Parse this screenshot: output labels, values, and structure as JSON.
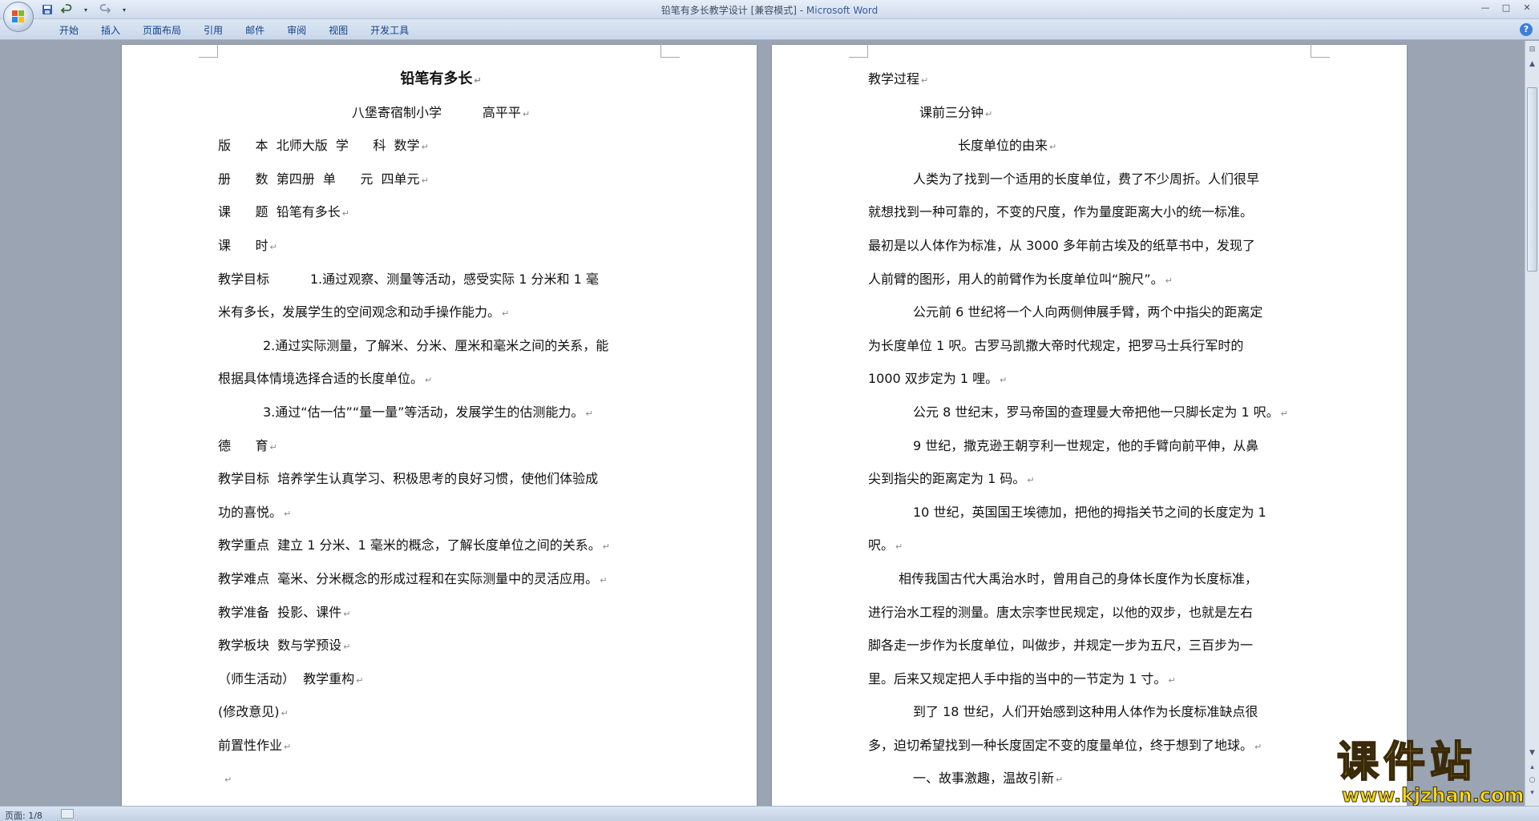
{
  "window": {
    "title": "铅笔有多长教学设计 [兼容模式] - ",
    "app_name": "Microsoft Word"
  },
  "qat": {
    "save_icon": "save-icon",
    "undo_icon": "undo-icon",
    "redo_icon": "redo-icon",
    "customize_icon": "dropdown-icon"
  },
  "ribbon": {
    "tabs": [
      "开始",
      "插入",
      "页面布局",
      "引用",
      "邮件",
      "审阅",
      "视图",
      "开发工具"
    ],
    "help": "?"
  },
  "page1": {
    "title": "铅笔有多长",
    "author_line": "八堡寄宿制小学          高平平",
    "lines": [
      "版      本  北师大版  学      科  数学",
      "册      数  第四册  单      元  四单元",
      "课      题  铅笔有多长",
      "课      时",
      "教学目标          1.通过观察、测量等活动，感受实际 1 分米和 1 毫",
      "米有多长，发展学生的空间观念和动手操作能力。",
      "2.通过实际测量，了解米、分米、厘米和毫米之间的关系，能",
      "根据具体情境选择合适的长度单位。",
      "3.通过“估一估”“量一量”等活动，发展学生的估测能力。",
      "德      育",
      "教学目标  培养学生认真学习、积极思考的良好习惯，使他们体验成",
      "功的喜悦。",
      "教学重点  建立 1 分米、1 毫米的概念，了解长度单位之间的关系。",
      "教学难点  毫米、分米概念的形成过程和在实际测量中的灵活应用。",
      "教学准备  投影、课件",
      "教学板块  数与学预设",
      "（师生活动）  教学重构",
      "(修改意见)",
      "前置性作业"
    ]
  },
  "page2": {
    "lines": [
      "教学过程",
      "课前三分钟",
      "长度单位的由来",
      "人类为了找到一个适用的长度单位，费了不少周折。人们很早",
      "就想找到一种可靠的，不变的尺度，作为量度距离大小的统一标准。",
      "最初是以人体作为标准，从 3000 多年前古埃及的纸草书中，发现了",
      "人前臂的图形，用人的前臂作为长度单位叫“腕尺”。",
      "公元前 6 世纪将一个人向两侧伸展手臂，两个中指尖的距离定",
      "为长度单位 1 呎。古罗马凯撒大帝时代规定，把罗马士兵行军时的",
      "1000 双步定为 1 哩。",
      "公元 8 世纪末，罗马帝国的查理曼大帝把他一只脚长定为 1 呎。",
      "9 世纪，撒克逊王朝亨利一世规定，他的手臂向前平伸，从鼻",
      "尖到指尖的距离定为 1 码。",
      "10 世纪，英国国王埃德加，把他的拇指关节之间的长度定为 1",
      "呎。",
      "相传我国古代大禹治水时，曾用自己的身体长度作为长度标准，",
      "进行治水工程的测量。唐太宗李世民规定，以他的双步，也就是左右",
      "脚各走一步作为长度单位，叫做步，并规定一步为五尺，三百步为一",
      "里。后来又规定把人手中指的当中的一节定为 1 寸。",
      "到了 18 世纪，人们开始感到这种用人体作为长度标准缺点很",
      "多，迫切希望找到一种长度固定不变的度量单位，终于想到了地球。",
      "一、故事激趣，温故引新"
    ]
  },
  "status": {
    "page": "页面: 1/8"
  },
  "watermark": {
    "main": "课件站",
    "url": "www.kjzhan.com"
  },
  "colors": {
    "ribbon_tab_text": "#15428b",
    "page_bg": "#ffffff",
    "workspace_bg": "#9aa4b2",
    "watermark": "#f5d91a"
  }
}
